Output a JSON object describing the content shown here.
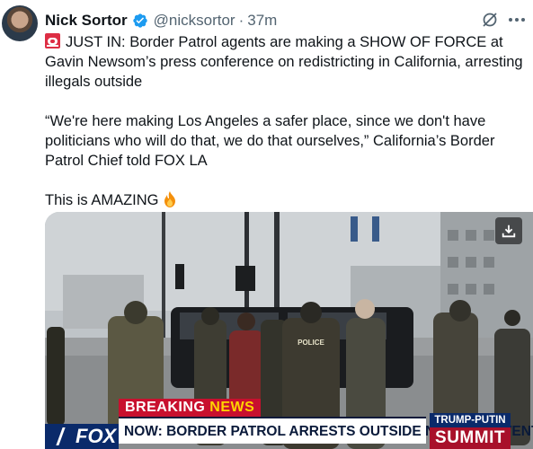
{
  "tweet": {
    "author_name": "Nick Sortor",
    "handle": "@nicksortor",
    "separator": "·",
    "timestamp": "37m",
    "lines": [
      "JUST IN: Border Patrol agents are making a SHOW OF FORCE at Gavin Newsom’s press conference on redistricting in California, arresting illegals outside",
      "“We're here making Los Angeles a safer place, since we don't have politicians who will do that, we do that ourselves,” California’s Border Patrol Chief told FOX LA",
      "This is AMAZING"
    ]
  },
  "media": {
    "breaking_prefix": "BREAKING",
    "breaking_suffix": " NEWS",
    "headline": "NOW: BORDER PATROL ARRESTS OUTSIDE NEWSOM EVENT",
    "network": "FOX",
    "summit_top": "TRUMP-PUTIN",
    "summit_bottom": "SUMMIT",
    "vest_text": "POLICE"
  },
  "icons": {
    "verified": "verified-badge-icon",
    "grok": "grok-icon",
    "more": "more-options-icon",
    "siren": "rotating-light-emoji",
    "fire": "fire-emoji",
    "download": "download-icon"
  },
  "colors": {
    "verified_blue": "#1d9bf0",
    "secondary_text": "#536471",
    "fox_red": "#c8102e",
    "fox_blue": "#0a2a6a"
  }
}
